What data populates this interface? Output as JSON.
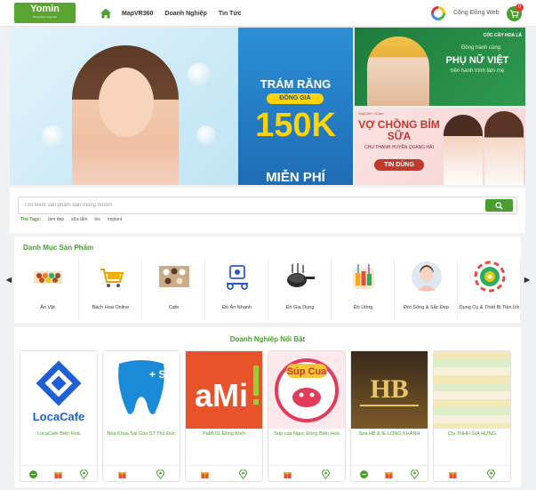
{
  "header": {
    "logo_text": "Yomin",
    "logo_sub": "đồng hành cùng bạn",
    "nav": [
      "MapVR360",
      "Doanh Nghiệp",
      "Tin Tức"
    ],
    "community": "Cộng Đồng Web",
    "cart_count": "0"
  },
  "hero": {
    "main": {
      "line1": "TRÁM RĂNG",
      "line2": "ĐỒNG GIÁ",
      "price": "150K",
      "line3": "MIỄN PHÍ"
    },
    "side_top": {
      "brand": "CÓC CÂY HOA LÁ",
      "small": "Đồng hành cùng",
      "big": "PHỤ NỮ VIỆT",
      "sub": "trên hành trình làm mẹ"
    },
    "side_bottom": {
      "brand": "SoyChef • iCare",
      "title": "VỢ CHỒNG BỈM SỮA",
      "sub": "CHU THANH HUYỀN QUANG HẢI",
      "badge": "TIN DÙNG"
    }
  },
  "search": {
    "placeholder": "Tìm kiếm sản phẩm bạn mong muốn!",
    "tags_label": "Thẻ Tags:",
    "tags": [
      "làm đẹp",
      "sữa tắm",
      "tóc",
      "implant"
    ]
  },
  "categories": {
    "title": "Danh Mục Sản Phẩm",
    "items": [
      {
        "label": "Ăn Vặt",
        "icon": "snack-icon"
      },
      {
        "label": "Bách Hoá Online",
        "icon": "grocery-cart-icon"
      },
      {
        "label": "Cafe",
        "icon": "cafe-icon"
      },
      {
        "label": "Đồ Ăn Nhanh",
        "icon": "delivery-icon"
      },
      {
        "label": "Đồ Gia Dụng",
        "icon": "cookware-icon"
      },
      {
        "label": "Đồ Uống",
        "icon": "drink-icon"
      },
      {
        "label": "Đời Sống & Sắc Đẹp",
        "icon": "beauty-icon"
      },
      {
        "label": "Dụng Cụ & Thiết Bị Tiện Ích",
        "icon": "gear-icon"
      }
    ]
  },
  "businesses": {
    "title": "Doanh Nghiệp Nổi Bật",
    "items": [
      {
        "name": "LocaCafe Biên Hoà",
        "logo": "LocaCafe"
      },
      {
        "name": "Nha Khoa Sài Gòn ST Thủ Đức",
        "logo": "+ ST"
      },
      {
        "name": "PaMi 01 Đồng Khởi",
        "logo": "aMi"
      },
      {
        "name": "Súp cua Ngọc Đồng Biên Hoà",
        "logo": "Súp Cua"
      },
      {
        "name": "Spa HB & IE LONG KHÁNH",
        "logo": "HB"
      },
      {
        "name": "Cty TNHH GIA HƯNG",
        "logo": ""
      }
    ]
  },
  "colors": {
    "accent": "#4a9d2f",
    "brand": "#5aa532",
    "sale": "#c0392b"
  }
}
